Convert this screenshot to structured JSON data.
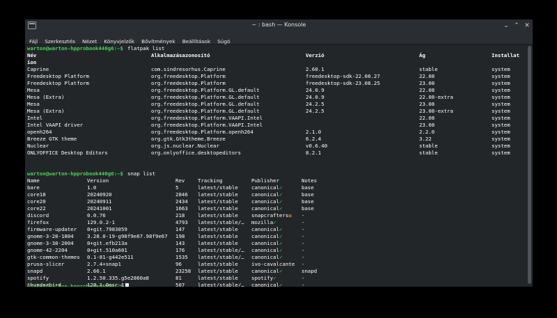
{
  "window": {
    "title": "~ : bash — Konsole"
  },
  "controls": {
    "minimize": "⌄",
    "maximize": "⌃",
    "close": "✕"
  },
  "menu": [
    "Fájl",
    "Szerkesztés",
    "Nézet",
    "Könyvjelzők",
    "Bővítmények",
    "Beállítások",
    "Súgó"
  ],
  "prompt": "warton@warton-hpprobook440g6:~$",
  "commands": {
    "flatpak": "flatpak list",
    "snap": "snap list"
  },
  "flatpak": {
    "headers": [
      "Név",
      "Alkalmazásazonosító",
      "Verzió",
      "Ág",
      "Installat"
    ],
    "header_wrap": "ion",
    "rows": [
      [
        "Caprine",
        "com.sindresorhus.Caprine",
        "2.60.1",
        "stable",
        "system"
      ],
      [
        "Freedesktop Platform",
        "org.freedesktop.Platform",
        "freedesktop-sdk-22.08.27",
        "22.08",
        "system"
      ],
      [
        "Freedesktop Platform",
        "org.freedesktop.Platform",
        "freedesktop-sdk-23.08.25",
        "23.08",
        "system"
      ],
      [
        "Mesa",
        "org.freedesktop.Platform.GL.default",
        "24.0.9",
        "22.08",
        "system"
      ],
      [
        "Mesa (Extra)",
        "org.freedesktop.Platform.GL.default",
        "24.0.9",
        "22.08-extra",
        "system"
      ],
      [
        "Mesa",
        "org.freedesktop.Platform.GL.default",
        "24.2.5",
        "23.08",
        "system"
      ],
      [
        "Mesa (Extra)",
        "org.freedesktop.Platform.GL.default",
        "24.2.5",
        "23.08-extra",
        "system"
      ],
      [
        "Intel",
        "org.freedesktop.Platform.VAAPI.Intel",
        "",
        "22.08",
        "system"
      ],
      [
        "Intel VAAPI driver",
        "org.freedesktop.Platform.VAAPI.Intel",
        "",
        "23.08",
        "system"
      ],
      [
        "openh264",
        "org.freedesktop.Platform.openh264",
        "2.1.0",
        "2.2.0",
        "system"
      ],
      [
        "Breeze GTK theme",
        "org.gtk.Gtk3theme.Breeze",
        "6.2.4",
        "3.22",
        "system"
      ],
      [
        "Nuclear",
        "org.js.nuclear.Nuclear",
        "v0.6.40",
        "stable",
        "system"
      ],
      [
        "ONLYOFFICE Desktop Editors",
        "org.onlyoffice.desktopeditors",
        "8.2.1",
        "stable",
        "system"
      ]
    ]
  },
  "snap": {
    "headers": [
      "Name",
      "Version",
      "Rev",
      "Tracking",
      "Publisher",
      "Notes"
    ],
    "rows": [
      [
        "bare",
        "1.0",
        "5",
        "latest/stable",
        "canonical",
        "✓",
        "base"
      ],
      [
        "core18",
        "20240920",
        "2846",
        "latest/stable",
        "canonical",
        "✓",
        "base"
      ],
      [
        "core20",
        "20240911",
        "2434",
        "latest/stable",
        "canonical",
        "✓",
        "base"
      ],
      [
        "core22",
        "20241001",
        "1663",
        "latest/stable",
        "canonical",
        "✓",
        "base"
      ],
      [
        "discord",
        "0.0.76",
        "218",
        "latest/stable",
        "snapcrafters",
        "✪",
        "-"
      ],
      [
        "firefox",
        "129.0.2-1",
        "4793",
        "latest/stable/…",
        "mozilla",
        "✓",
        "-"
      ],
      [
        "firmware-updater",
        "0+git.7983059",
        "147",
        "latest/stable",
        "canonical",
        "✓",
        "-"
      ],
      [
        "gnome-3-28-1804",
        "3.28.0-19-g98f9e67.98f9e67",
        "198",
        "latest/stable",
        "canonical",
        "✓",
        "-"
      ],
      [
        "gnome-3-38-2004",
        "0+git.efb213a",
        "143",
        "latest/stable",
        "canonical",
        "✓",
        "-"
      ],
      [
        "gnome-42-2204",
        "0+git.510a601",
        "176",
        "latest/stable/…",
        "canonical",
        "✓",
        "-"
      ],
      [
        "gtk-common-themes",
        "0.1-81-g442e511",
        "1535",
        "latest/stable/…",
        "canonical",
        "✓",
        "-"
      ],
      [
        "prusa-slicer",
        "2.7.4+snap1",
        "96",
        "latest/stable",
        "ivo-cavalcante",
        "",
        "-"
      ],
      [
        "snapd",
        "2.66.1",
        "23258",
        "latest/stable",
        "canonical",
        "✓",
        "snapd"
      ],
      [
        "spotify",
        "1.2.50.335.g5e2860a8",
        "81",
        "latest/stable",
        "spotify",
        "✓",
        "-"
      ],
      [
        "thunderbird",
        "128.1.0esr-1",
        "507",
        "latest/stable/…",
        "canonical",
        "✓",
        "-"
      ]
    ]
  }
}
